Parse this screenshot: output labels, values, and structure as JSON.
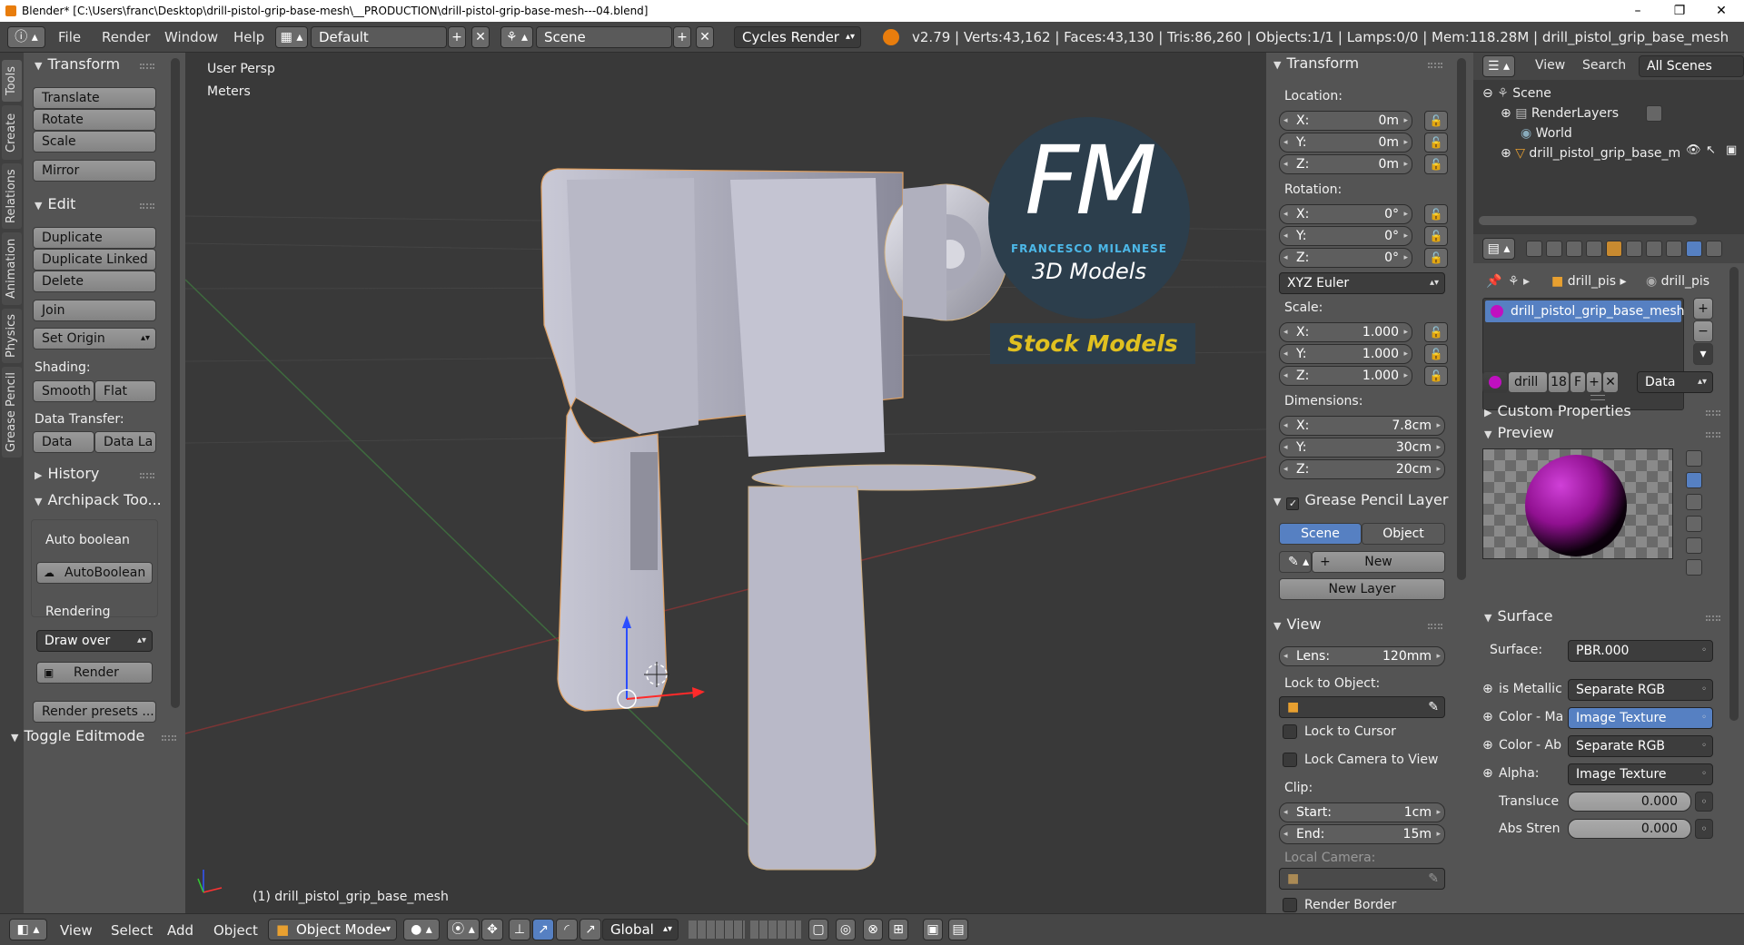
{
  "window": {
    "title": "Blender* [C:\\Users\\franc\\Desktop\\drill-pistol-grip-base-mesh\\__PRODUCTION\\drill-pistol-grip-base-mesh---04.blend]"
  },
  "menu": {
    "items": [
      "File",
      "Render",
      "Window",
      "Help"
    ],
    "layout": "Default",
    "scene": "Scene",
    "engine": "Cycles Render"
  },
  "stats": "v2.79 | Verts:43,162 | Faces:43,130 | Tris:86,260 | Objects:1/1 | Lamps:0/0 | Mem:118.28M | drill_pistol_grip_base_mesh",
  "tool_tabs": [
    "Tools",
    "Create",
    "Relations",
    "Animation",
    "Physics",
    "Grease Pencil"
  ],
  "toolshelf": {
    "transform_header": "Transform",
    "transform_buttons": [
      "Translate",
      "Rotate",
      "Scale"
    ],
    "mirror": "Mirror",
    "edit_header": "Edit",
    "edit_buttons": [
      "Duplicate",
      "Duplicate Linked",
      "Delete"
    ],
    "join": "Join",
    "set_origin": "Set Origin",
    "shading_label": "Shading:",
    "smooth": "Smooth",
    "flat": "Flat",
    "data_transfer_label": "Data Transfer:",
    "data": "Data",
    "data_la": "Data La",
    "history_header": "History",
    "archipack_header": "Archipack Too...",
    "auto_boolean_label": "Auto boolean",
    "auto_boolean_btn": "AutoBoolean",
    "rendering_label": "Rendering",
    "draw_over": "Draw over",
    "render_btn": "Render",
    "render_presets": "Render presets ...",
    "toggle_editmode": "Toggle Editmode"
  },
  "viewport": {
    "view_name": "User Persp",
    "units": "Meters",
    "object_label": "(1) drill_pistol_grip_base_mesh",
    "logo_big": "FM",
    "logo_name": "FRANCESCO MILANESE",
    "logo_sub": "3D Models",
    "logo_banner": "Stock Models"
  },
  "npanel": {
    "transform_header": "Transform",
    "location_label": "Location:",
    "location": [
      {
        "k": "X:",
        "v": "0m"
      },
      {
        "k": "Y:",
        "v": "0m"
      },
      {
        "k": "Z:",
        "v": "0m"
      }
    ],
    "rotation_label": "Rotation:",
    "rotation": [
      {
        "k": "X:",
        "v": "0°"
      },
      {
        "k": "Y:",
        "v": "0°"
      },
      {
        "k": "Z:",
        "v": "0°"
      }
    ],
    "rotation_mode": "XYZ Euler",
    "scale_label": "Scale:",
    "scale": [
      {
        "k": "X:",
        "v": "1.000"
      },
      {
        "k": "Y:",
        "v": "1.000"
      },
      {
        "k": "Z:",
        "v": "1.000"
      }
    ],
    "dimensions_label": "Dimensions:",
    "dimensions": [
      {
        "k": "X:",
        "v": "7.8cm"
      },
      {
        "k": "Y:",
        "v": "30cm"
      },
      {
        "k": "Z:",
        "v": "20cm"
      }
    ],
    "gp_header": "Grease Pencil Layer",
    "gp_scene": "Scene",
    "gp_object": "Object",
    "gp_new": "New",
    "gp_new_layer": "New Layer",
    "view_header": "View",
    "lens_label": "Lens:",
    "lens_value": "120mm",
    "lock_to_object": "Lock to Object:",
    "lock_cursor": "Lock to Cursor",
    "lock_camera": "Lock Camera to View",
    "clip_label": "Clip:",
    "clip_start_k": "Start:",
    "clip_start_v": "1cm",
    "clip_end_k": "End:",
    "clip_end_v": "15m",
    "local_camera": "Local Camera:",
    "render_border": "Render Border"
  },
  "outliner": {
    "tabs": [
      "View",
      "Search",
      "All Scenes"
    ],
    "rows": [
      "Scene",
      "RenderLayers",
      "World",
      "drill_pistol_grip_base_m"
    ]
  },
  "properties": {
    "breadcrumb1": "drill_pis",
    "breadcrumb2": "drill_pis",
    "material_slot": "drill_pistol_grip_base_mesh",
    "mat_name": "drill",
    "mat_users": "18",
    "mat_f": "F",
    "mat_data": "Data",
    "custom_props": "Custom Properties",
    "preview": "Preview",
    "surface_header": "Surface",
    "surface_label": "Surface:",
    "surface_value": "PBR.000",
    "inputs": [
      {
        "k": "is Metallic",
        "v": "Separate RGB"
      },
      {
        "k": "Color - Ma",
        "v": "Image Texture"
      },
      {
        "k": "Color - Ab",
        "v": "Separate RGB"
      },
      {
        "k": "Alpha:",
        "v": "Image Texture"
      }
    ],
    "translucent_k": "Transluce",
    "translucent_v": "0.000",
    "abs_k": "Abs Stren",
    "abs_v": "0.000"
  },
  "bottombar": {
    "items": [
      "View",
      "Select",
      "Add",
      "Object"
    ],
    "mode": "Object Mode",
    "orientation": "Global"
  }
}
